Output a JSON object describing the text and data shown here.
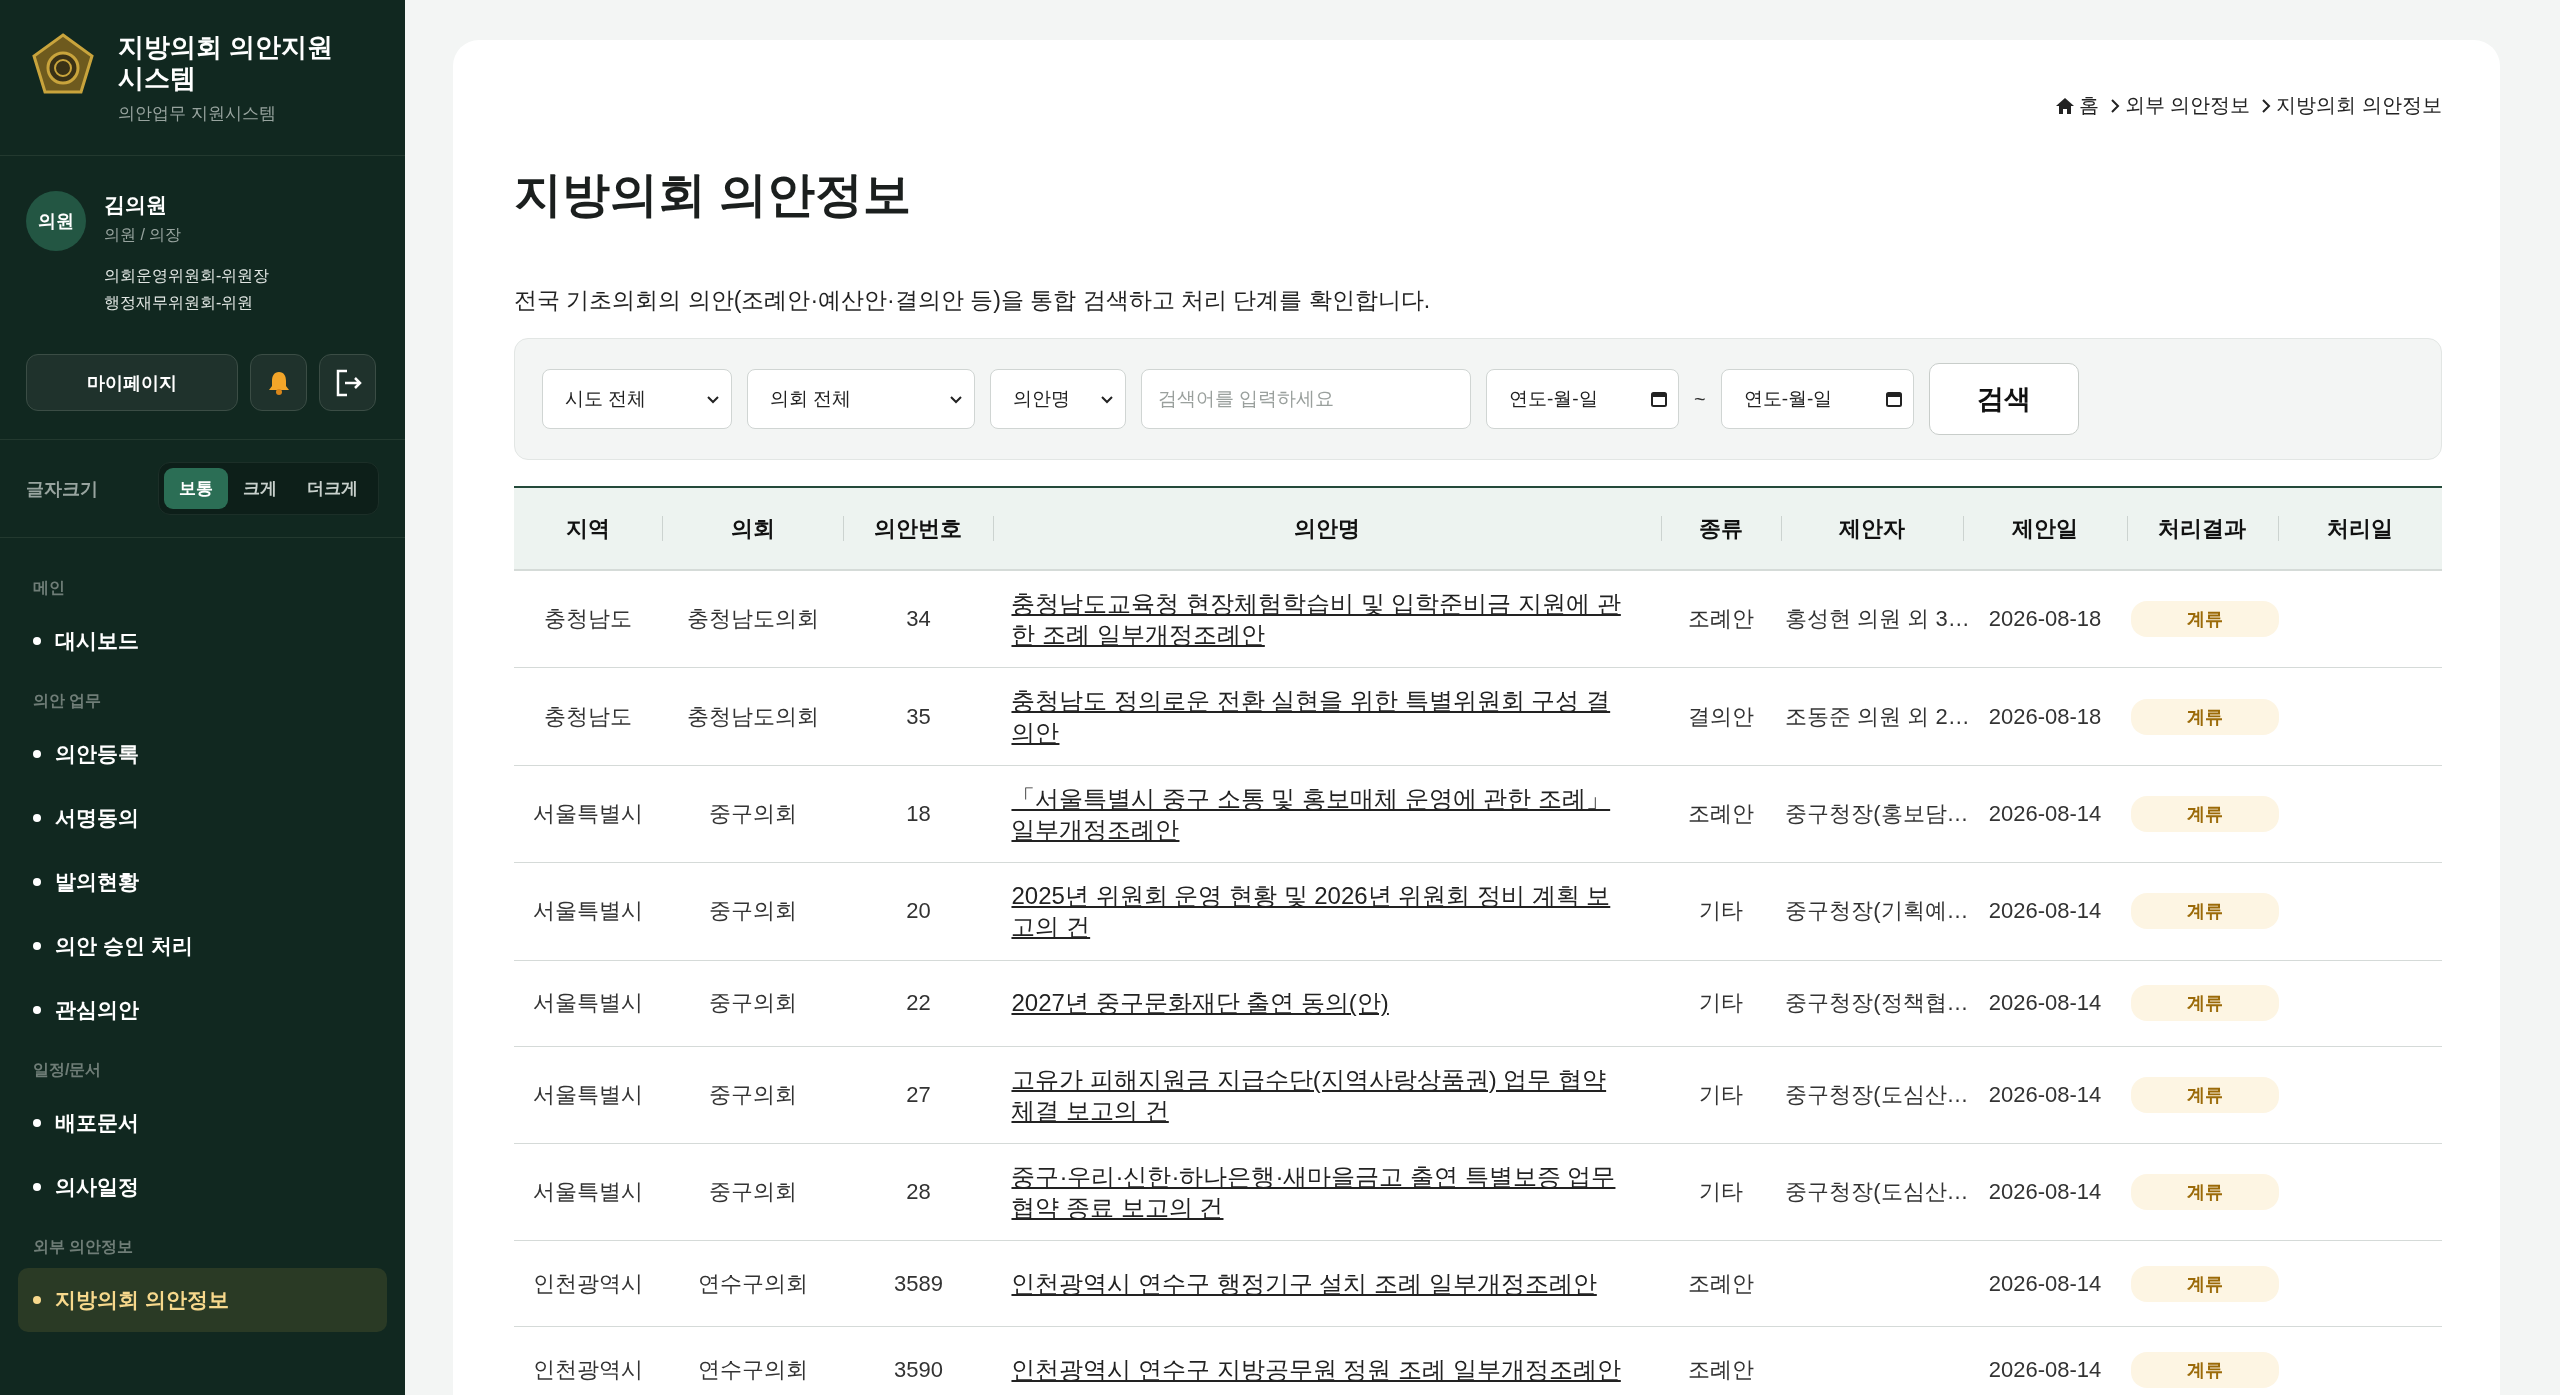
{
  "sidebar": {
    "brand": {
      "title": "지방의회 의안지원 시스템",
      "subtitle": "의안업무 지원시스템"
    },
    "profile": {
      "avatar": "의원",
      "name": "김의원",
      "role": "의원 / 의장",
      "committees": [
        "의회운영위원회-위원장",
        "행정재무위원회-위원"
      ]
    },
    "mypage_button": "마이페이지",
    "font_size": {
      "label": "글자크기",
      "options": [
        {
          "label": "보통",
          "selected": true
        },
        {
          "label": "크게",
          "selected": false
        },
        {
          "label": "더크게",
          "selected": false
        }
      ]
    },
    "nav": [
      {
        "heading": "메인",
        "items": [
          {
            "label": "대시보드",
            "selected": false
          }
        ]
      },
      {
        "heading": "의안 업무",
        "items": [
          {
            "label": "의안등록",
            "selected": false
          },
          {
            "label": "서명동의",
            "selected": false
          },
          {
            "label": "발의현황",
            "selected": false
          },
          {
            "label": "의안 승인 처리",
            "selected": false
          },
          {
            "label": "관심의안",
            "selected": false
          }
        ]
      },
      {
        "heading": "일정/문서",
        "items": [
          {
            "label": "배포문서",
            "selected": false
          },
          {
            "label": "의사일정",
            "selected": false
          }
        ]
      },
      {
        "heading": "외부 의안정보",
        "items": [
          {
            "label": "지방의회 의안정보",
            "selected": true
          }
        ]
      }
    ]
  },
  "breadcrumb": [
    "홈",
    "외부 의안정보",
    "지방의회 의안정보"
  ],
  "page_title": "지방의회 의안정보",
  "description": "전국 기초의회의 의안(조례안·예산안·결의안 등)을 통합 검색하고 처리 단계를 확인합니다.",
  "filters": {
    "region": "시도 전체",
    "council": "의회 전체",
    "field": "의안명",
    "search": {
      "placeholder": "검색어를 입력하세요"
    },
    "date_from": "연도-월-일",
    "separator": "~",
    "date_to": "연도-월-일",
    "search_button": "검색"
  },
  "table": {
    "columns": [
      "지역",
      "의회",
      "의안번호",
      "의안명",
      "종류",
      "제안자",
      "제안일",
      "처리결과",
      "처리일"
    ],
    "rows": [
      {
        "region": "충청남도",
        "council": "충청남도의회",
        "number": "34",
        "title": "충청남도교육청 현장체험학습비 및 입학준비금 지원에 관한 조례 일부개정조례안",
        "type": "조례안",
        "proposer": "홍성현 의원 외 3…",
        "date": "2026-08-18",
        "result": "계류"
      },
      {
        "region": "충청남도",
        "council": "충청남도의회",
        "number": "35",
        "title": "충청남도 정의로운 전환 실현을 위한 특별위원회 구성 결의안",
        "type": "결의안",
        "proposer": "조동준 의원 외 2…",
        "date": "2026-08-18",
        "result": "계류"
      },
      {
        "region": "서울특별시",
        "council": "중구의회",
        "number": "18",
        "title": "「서울특별시 중구 소통 및 홍보매체 운영에 관한 조례」 일부개정조례안",
        "type": "조례안",
        "proposer": "중구청장(홍보담…",
        "date": "2026-08-14",
        "result": "계류"
      },
      {
        "region": "서울특별시",
        "council": "중구의회",
        "number": "20",
        "title": "2025년 위원회 운영 현황 및 2026년 위원회 정비 계획 보고의 건",
        "type": "기타",
        "proposer": "중구청장(기획예…",
        "date": "2026-08-14",
        "result": "계류"
      },
      {
        "region": "서울특별시",
        "council": "중구의회",
        "number": "22",
        "title": "2027년 중구문화재단 출연 동의(안)",
        "type": "기타",
        "proposer": "중구청장(정책협…",
        "date": "2026-08-14",
        "result": "계류"
      },
      {
        "region": "서울특별시",
        "council": "중구의회",
        "number": "27",
        "title": "고유가 피해지원금 지급수단(지역사랑상품권) 업무 협약 체결 보고의 건",
        "type": "기타",
        "proposer": "중구청장(도심산…",
        "date": "2026-08-14",
        "result": "계류"
      },
      {
        "region": "서울특별시",
        "council": "중구의회",
        "number": "28",
        "title": "중구·우리·신한·하나은행·새마을금고 출연 특별보증 업무협약 종료 보고의 건",
        "type": "기타",
        "proposer": "중구청장(도심산…",
        "date": "2026-08-14",
        "result": "계류"
      },
      {
        "region": "인천광역시",
        "council": "연수구의회",
        "number": "3589",
        "title": "인천광역시 연수구 행정기구 설치 조례 일부개정조례안",
        "type": "조례안",
        "date": "2026-08-14",
        "result": "계류"
      },
      {
        "region": "인천광역시",
        "council": "연수구의회",
        "number": "3590",
        "title": "인천광역시 연수구 지방공무원 정원 조례 일부개정조례안",
        "type": "조례안",
        "date": "2026-08-14",
        "result": "계류"
      }
    ]
  }
}
